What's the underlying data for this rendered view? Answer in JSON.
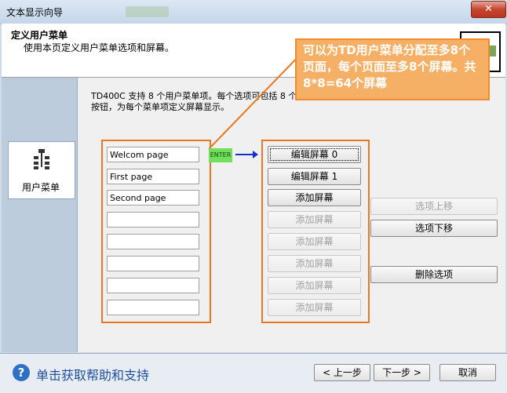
{
  "window": {
    "title": "文本显示向导",
    "close_label": "✕"
  },
  "header": {
    "title": "定义用户菜单",
    "subtitle": "使用本页定义用户菜单选项和屏幕。"
  },
  "sidebar": {
    "item_label": "用户菜单",
    "item_icon": "menu-tree-icon"
  },
  "description": "TD400C 支持 8 个用户菜单项。每个选项可包括 8 个屏幕。在项中点击此所选菜单中，再击右面的按钮，为每个菜单项定义屏幕显示。",
  "callout": "可以为TD用户菜单分配至多8个页面，每个页面至多8个屏幕。共8*8=64个屏幕",
  "enter_label": "ENTER",
  "menu_items": [
    "Welcom page",
    "First page",
    "Second page",
    "",
    "",
    "",
    "",
    ""
  ],
  "screen_buttons": [
    {
      "label": "编辑屏幕 0",
      "enabled": true
    },
    {
      "label": "编辑屏幕 1",
      "enabled": true
    },
    {
      "label": "添加屏幕",
      "enabled": true
    },
    {
      "label": "添加屏幕",
      "enabled": false
    },
    {
      "label": "添加屏幕",
      "enabled": false
    },
    {
      "label": "添加屏幕",
      "enabled": false
    },
    {
      "label": "添加屏幕",
      "enabled": false
    },
    {
      "label": "添加屏幕",
      "enabled": false
    }
  ],
  "option_buttons": {
    "move_up": "选项上移",
    "move_down": "选项下移",
    "delete": "删除选项"
  },
  "footer": {
    "help": "单击获取帮助和支持",
    "prev": "< 上一步",
    "next": "下一步 >",
    "cancel": "取消"
  },
  "colors": {
    "accent": "#e87722",
    "callout_fill": "#f6b066",
    "arrow": "#1030d0",
    "enter": "#6fe05a"
  }
}
